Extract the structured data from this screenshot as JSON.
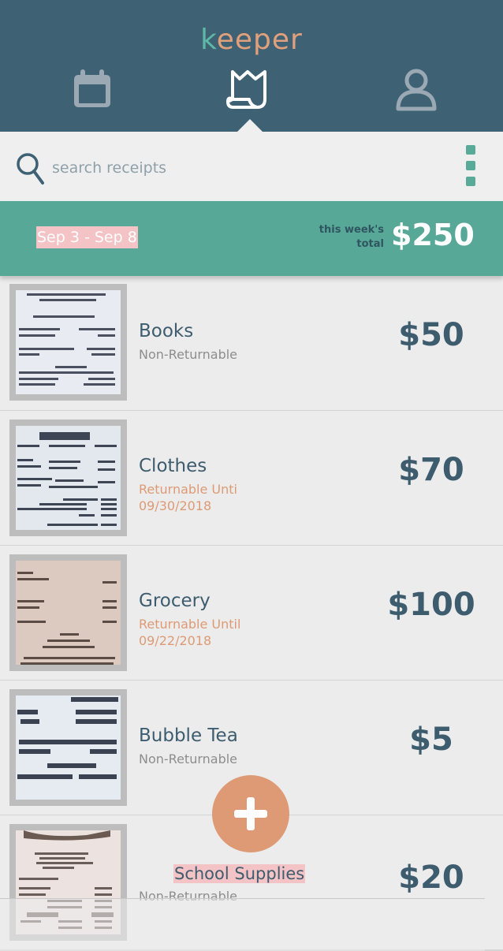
{
  "app": {
    "logo_first": "k",
    "logo_rest": "eeper"
  },
  "nav": {
    "items": [
      {
        "icon": "calendar-icon",
        "active": false
      },
      {
        "icon": "receipt-icon",
        "active": true
      },
      {
        "icon": "profile-icon",
        "active": false
      }
    ]
  },
  "search": {
    "placeholder": "search receipts"
  },
  "week": {
    "range": "Sep 3 - Sep 8",
    "total_label_line1": "this week's",
    "total_label_line2": "total",
    "total": "$250"
  },
  "receipts": [
    {
      "name": "Books",
      "status_line1": "Non-Returnable",
      "status_line2": "",
      "amount": "$50",
      "returnable": false
    },
    {
      "name": "Clothes",
      "status_line1": "Returnable Unti",
      "status_line2": "09/30/2018",
      "amount": "$70",
      "returnable": true
    },
    {
      "name": "Grocery",
      "status_line1": "Returnable Until",
      "status_line2": "09/22/2018",
      "amount": "$100",
      "returnable": true
    },
    {
      "name": "Bubble Tea",
      "status_line1": "Non-Returnable",
      "status_line2": "",
      "amount": "$5",
      "returnable": false
    },
    {
      "name": "School Supplies",
      "status_line1": "Non-Returnable",
      "status_line2": "",
      "amount": "$20",
      "returnable": false
    }
  ],
  "colors": {
    "header": "#3e6174",
    "accent_teal": "#58a898",
    "accent_orange": "#dd9a75",
    "text_dark": "#3d5c6e",
    "highlight_pink": "#f4c3c5"
  }
}
